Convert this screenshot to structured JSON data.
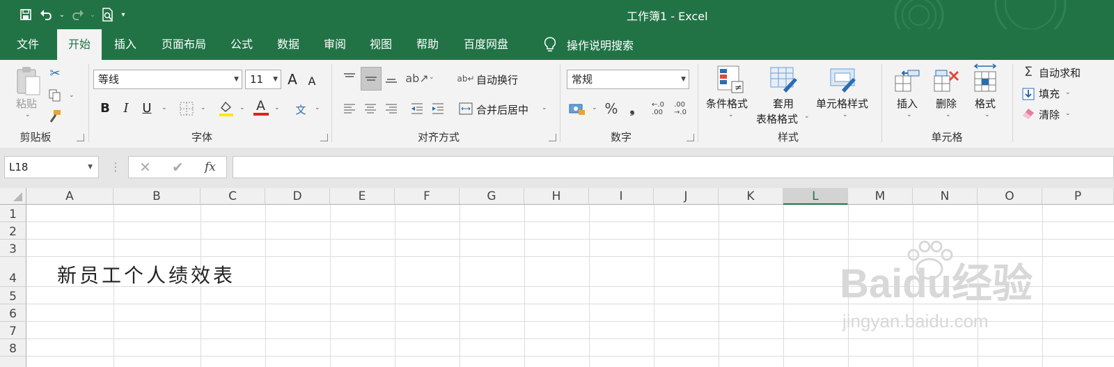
{
  "window": {
    "title": "工作簿1  -  Excel"
  },
  "qat": {
    "more": "▾"
  },
  "tabs": [
    {
      "label": "文件"
    },
    {
      "label": "开始"
    },
    {
      "label": "插入"
    },
    {
      "label": "页面布局"
    },
    {
      "label": "公式"
    },
    {
      "label": "数据"
    },
    {
      "label": "审阅"
    },
    {
      "label": "视图"
    },
    {
      "label": "帮助"
    },
    {
      "label": "百度网盘"
    }
  ],
  "tell_me": {
    "label": "操作说明搜索"
  },
  "clipboard": {
    "paste_label": "粘贴",
    "group": "剪贴板"
  },
  "font": {
    "name": "等线",
    "size": "11",
    "group": "字体",
    "grow": "A",
    "shrink": "A",
    "bold": "B",
    "italic": "I",
    "underline": "U",
    "phonetic": "文"
  },
  "alignment": {
    "wrap": "自动换行",
    "merge": "合并后居中",
    "group": "对齐方式"
  },
  "number": {
    "format": "常规",
    "percent": "%",
    "comma": "❟",
    "group": "数字"
  },
  "styles": {
    "conditional": "条件格式",
    "table1": "套用",
    "table2": "表格格式",
    "cell_styles": "单元格样式",
    "group": "样式"
  },
  "cells": {
    "insert": "插入",
    "delete": "删除",
    "format": "格式",
    "group": "单元格"
  },
  "editing": {
    "autosum": "自动求和",
    "fill": "填充",
    "clear": "清除"
  },
  "formula_bar": {
    "name_box": "L18",
    "fx": "fx",
    "value": ""
  },
  "columns": [
    "A",
    "B",
    "C",
    "D",
    "E",
    "F",
    "G",
    "H",
    "I",
    "J",
    "K",
    "L",
    "M",
    "N",
    "O",
    "P"
  ],
  "selected_column": "L",
  "rows": [
    "1",
    "2",
    "3",
    "4",
    "5",
    "6",
    "7",
    "8"
  ],
  "cells_content": {
    "A4": "新员工个人绩效表"
  },
  "watermark": {
    "brand": "Baidu经验",
    "url": "jingyan.baidu.com"
  },
  "colors": {
    "excel_green": "#217346",
    "font_color_red": "#e02020"
  }
}
